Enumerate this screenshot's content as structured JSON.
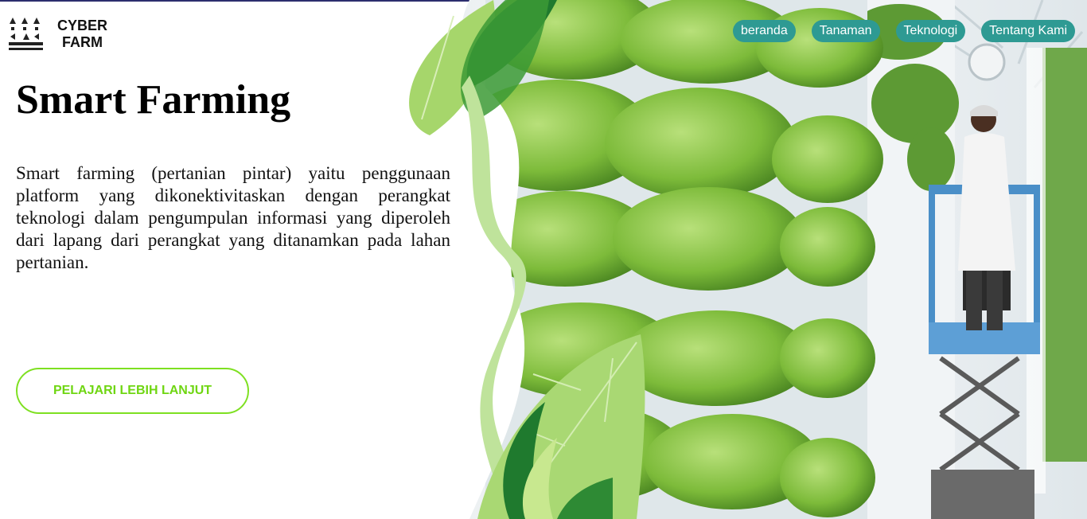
{
  "brand": {
    "line1": "CYBER",
    "line2": "FARM",
    "icon": "farm-sprinkler-icon"
  },
  "nav": {
    "items": [
      {
        "label": "beranda"
      },
      {
        "label": "Tanaman"
      },
      {
        "label": "Teknologi"
      },
      {
        "label": "Tentang Kami"
      }
    ]
  },
  "hero": {
    "title": "Smart Farming",
    "description": "Smart farming (pertanian pintar) yaitu penggunaan platform yang dikonektivitaskan dengan perangkat teknologi dalam pengumpulan informasi yang diperoleh dari lapang dari perangkat yang ditanamkan pada lahan pertanian.",
    "cta_label": "PELAJARI LEBIH LANJUT"
  },
  "colors": {
    "nav_bg": "#2e9a93",
    "cta_accent": "#7ee021",
    "leaf_light": "#a6d66b",
    "leaf_dark": "#1f7a2e"
  }
}
